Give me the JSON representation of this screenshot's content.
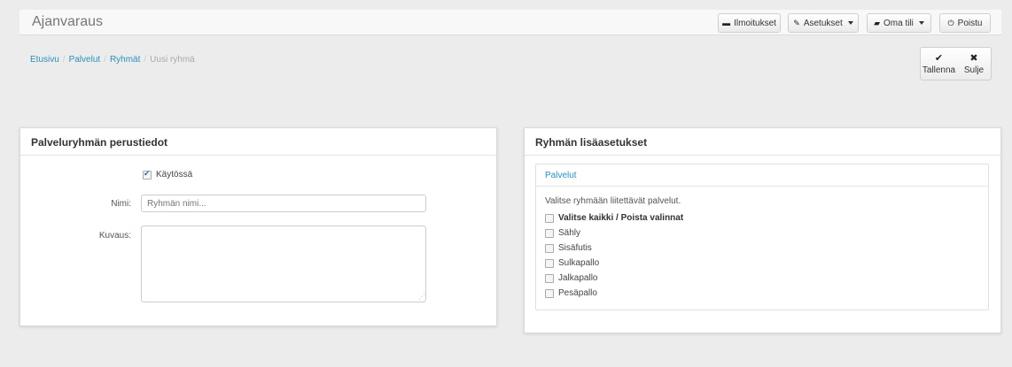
{
  "app": {
    "title": "Ajanvaraus"
  },
  "topbar": {
    "notifications": {
      "label": "Ilmoitukset",
      "icon": "comment-icon"
    },
    "settings": {
      "label": "Asetukset",
      "icon": "wrench-icon"
    },
    "account": {
      "label": "Oma tili",
      "icon": "briefcase-icon"
    },
    "logout": {
      "label": "Poistu",
      "icon": "power-icon"
    }
  },
  "breadcrumb": {
    "items": [
      "Etusivu",
      "Palvelut",
      "Ryhmät"
    ],
    "current": "Uusi ryhmä",
    "separator": "/"
  },
  "actions": {
    "save": {
      "label": "Tallenna",
      "icon": "check-icon"
    },
    "close": {
      "label": "Sulje",
      "icon": "close-icon"
    }
  },
  "basic_panel": {
    "title": "Palveluryhmän perustiedot",
    "enabled_label": "Käytössä",
    "enabled": true,
    "name_label": "Nimi:",
    "name_placeholder": "Ryhmän nimi...",
    "name_value": "",
    "description_label": "Kuvaus:",
    "description_value": ""
  },
  "extra_panel": {
    "title": "Ryhmän lisäasetukset",
    "services_tab": "Palvelut",
    "instructions": "Valitse ryhmään liitettävät palvelut.",
    "select_all_label": "Valitse kaikki / Poista valinnat",
    "services": [
      {
        "label": "Sähly",
        "checked": false
      },
      {
        "label": "Sisäfutis",
        "checked": false
      },
      {
        "label": "Sulkapallo",
        "checked": false
      },
      {
        "label": "Jalkapallo",
        "checked": false
      },
      {
        "label": "Pesäpallo",
        "checked": false
      }
    ]
  },
  "colors": {
    "link": "#2a8fbd",
    "background": "#ececec",
    "panel": "#ffffff"
  }
}
